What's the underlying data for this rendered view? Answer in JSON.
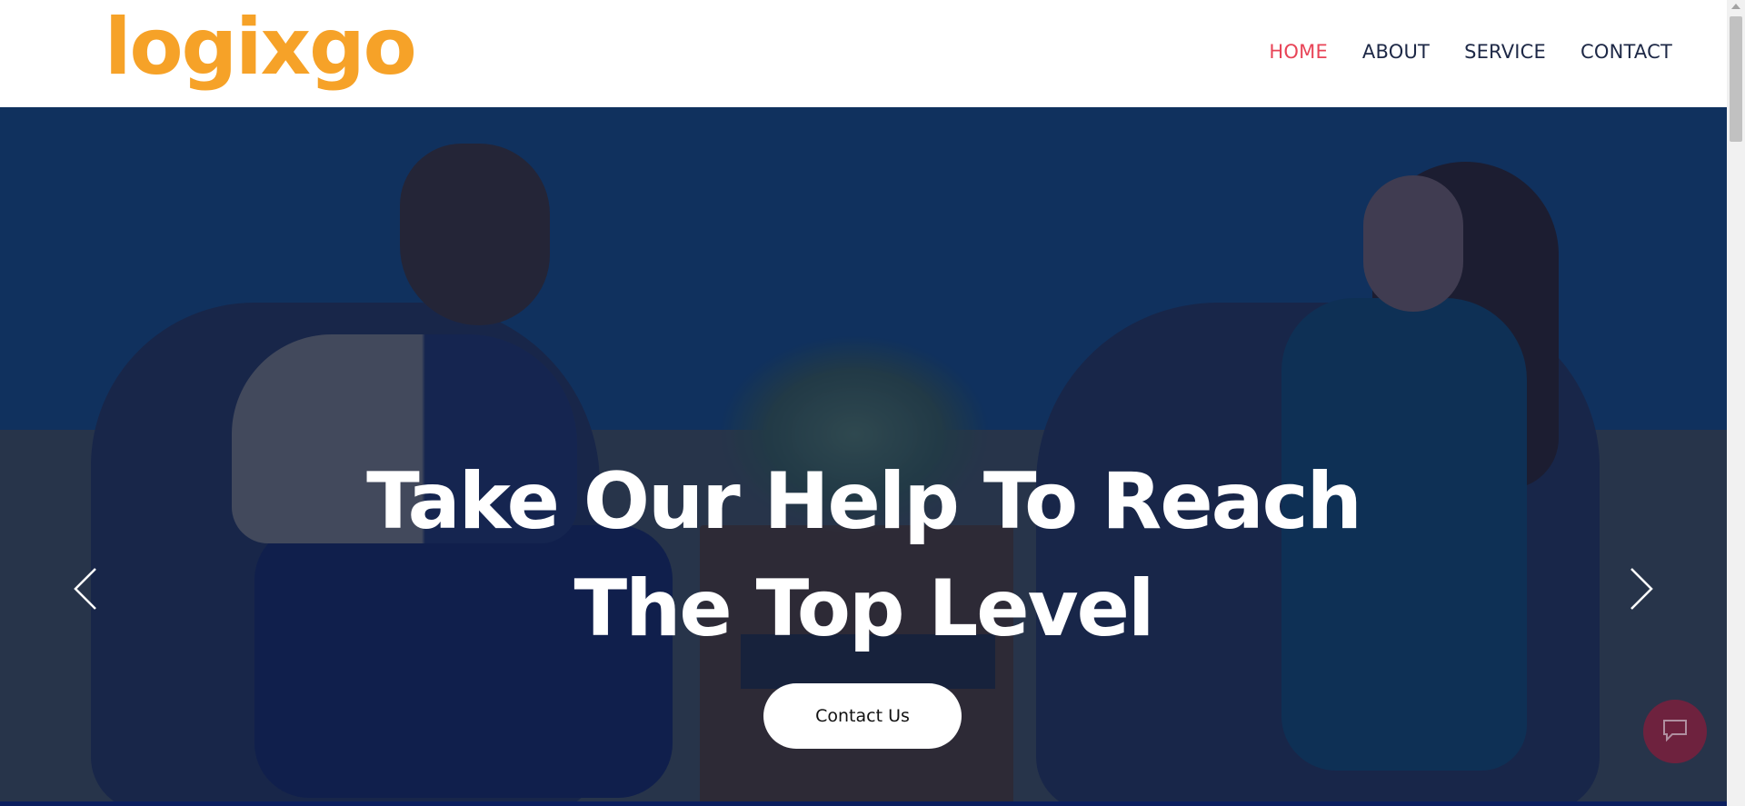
{
  "brand": {
    "logo": "logixgo"
  },
  "nav": {
    "items": [
      {
        "label": "HOME",
        "active": true
      },
      {
        "label": "ABOUT",
        "active": false
      },
      {
        "label": "SERVICE",
        "active": false
      },
      {
        "label": "CONTACT",
        "active": false
      }
    ]
  },
  "hero": {
    "title_line1": "Take Our Help To Reach",
    "title_line2": "The Top Level",
    "cta_label": "Contact Us",
    "prev_icon": "chevron-left-icon",
    "next_icon": "chevron-right-icon"
  },
  "chat": {
    "icon": "chat-icon"
  },
  "colors": {
    "logo": "#f6a228",
    "nav_text": "#1d2846",
    "nav_active": "#e84457",
    "hero_overlay": "#0a1e50",
    "button_bg": "#ffffff"
  }
}
